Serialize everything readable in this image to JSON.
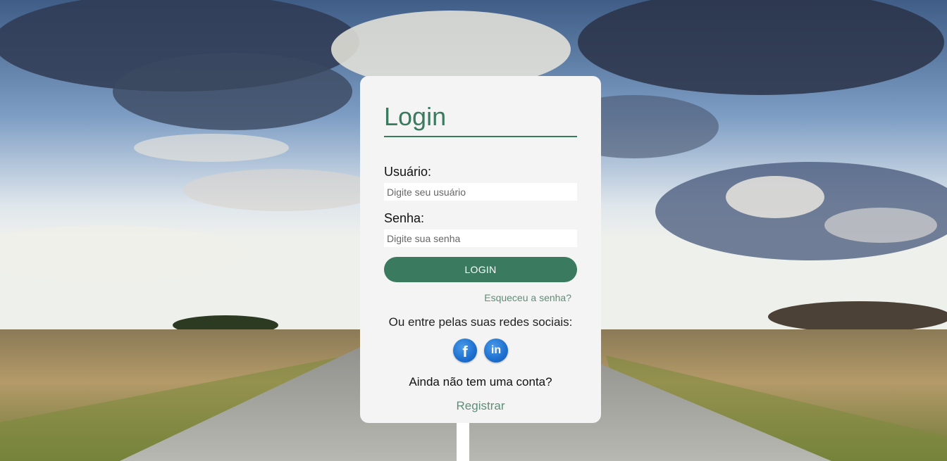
{
  "login_card": {
    "title": "Login",
    "username_label": "Usuário:",
    "username_placeholder": "Digite seu usuário",
    "password_label": "Senha:",
    "password_placeholder": "Digite sua senha",
    "login_button_label": "LOGIN",
    "forgot_password_link": "Esqueceu a senha?",
    "social_prompt": "Ou entre pelas suas redes sociais:",
    "social_networks": [
      {
        "name": "Facebook",
        "icon": "facebook-icon",
        "glyph": "f"
      },
      {
        "name": "LinkedIn",
        "icon": "linkedin-icon",
        "glyph": "in"
      }
    ],
    "no_account_text": "Ainda não tem uma conta?",
    "register_link": "Registrar"
  },
  "colors": {
    "accent": "#3a7a5e",
    "link": "#5e8e78",
    "card_background": "#f4f4f4",
    "social_blue": "#1d6fcf"
  },
  "background": {
    "description_icon": "road-landscape-photo"
  }
}
